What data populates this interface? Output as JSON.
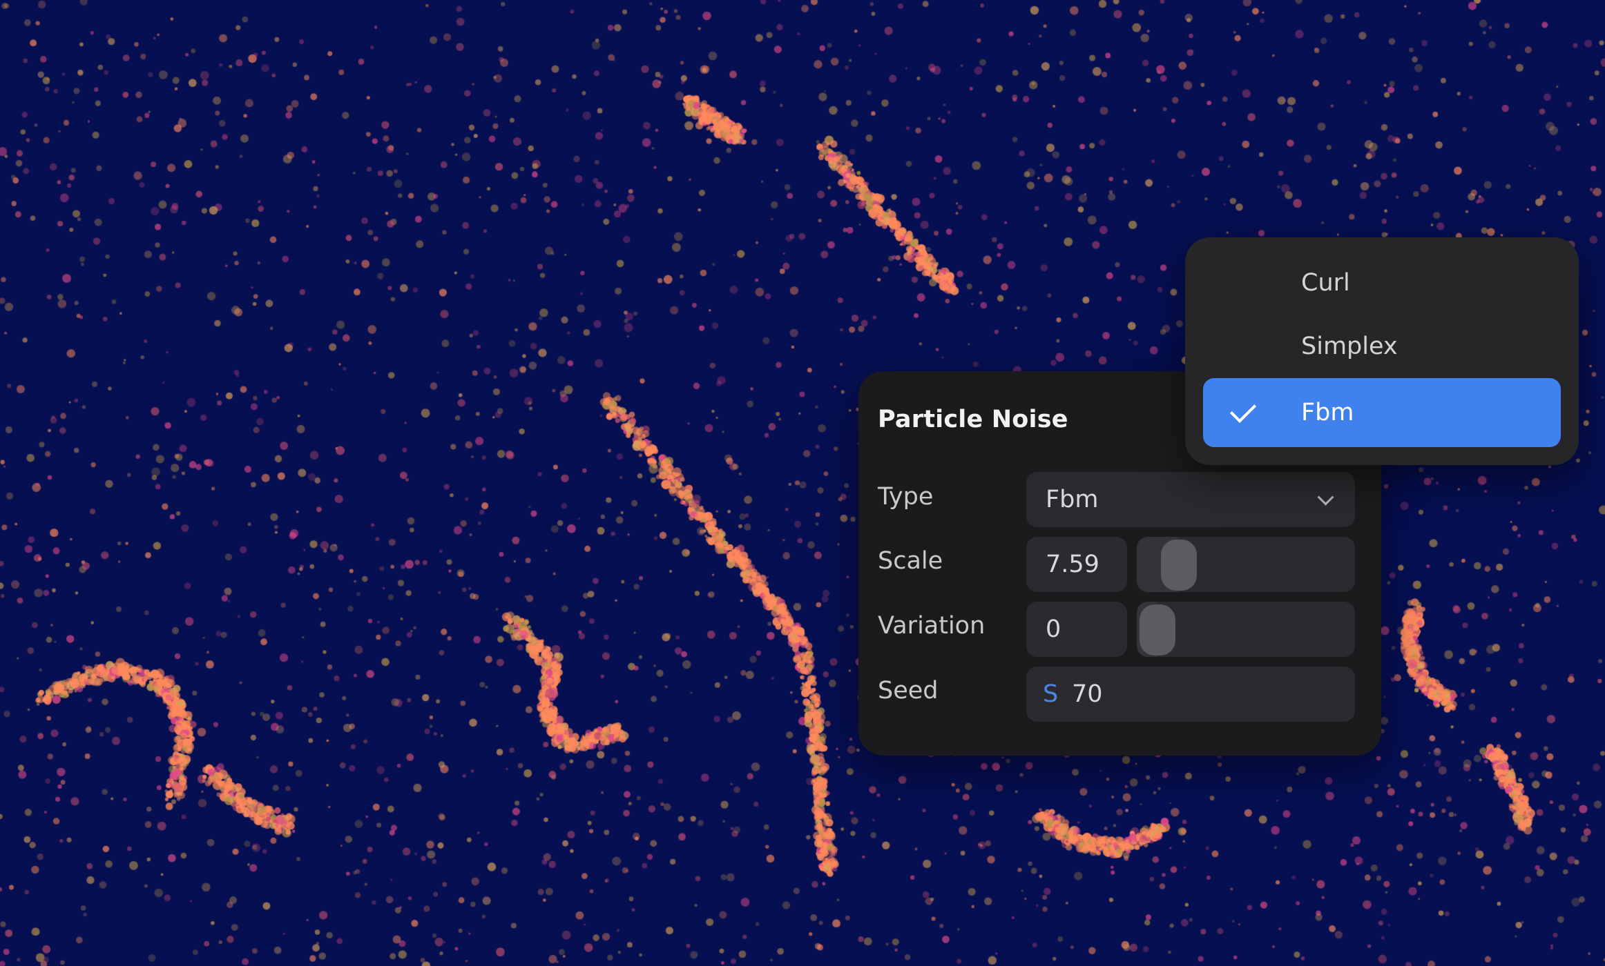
{
  "panel": {
    "title": "Particle Noise",
    "type": {
      "label": "Type",
      "value": "Fbm"
    },
    "scale": {
      "label": "Scale",
      "value": "7.59",
      "slider_level": 0.12
    },
    "variation": {
      "label": "Variation",
      "value": "0",
      "slider_level": 0.0
    },
    "seed": {
      "label": "Seed",
      "prefix": "S",
      "value": "70"
    }
  },
  "type_menu": {
    "options": [
      {
        "label": "Curl",
        "selected": false
      },
      {
        "label": "Simplex",
        "selected": false
      },
      {
        "label": "Fbm",
        "selected": true
      }
    ]
  },
  "colors": {
    "background": "#060f52",
    "panel": "#1b1b1e",
    "accent": "#3f82ee",
    "particle_warm": "#ff8a5c",
    "particle_pink": "#e04a8a",
    "particle_olive": "#b8924a"
  },
  "icons": {
    "dropdown": "chevron-down-icon",
    "selected": "checkmark-icon"
  }
}
